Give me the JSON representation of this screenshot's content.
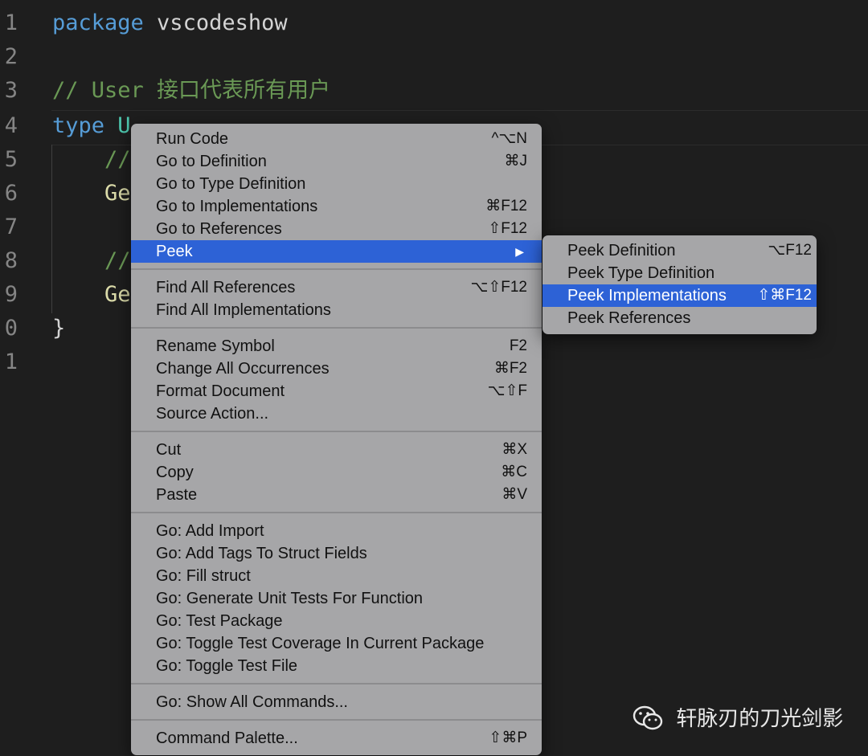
{
  "editor": {
    "lines": [
      {
        "num": "1",
        "tokens": [
          {
            "t": "package",
            "c": "kw"
          },
          {
            "t": " vscodeshow",
            "c": "plain"
          }
        ]
      },
      {
        "num": "2",
        "tokens": []
      },
      {
        "num": "3",
        "tokens": [
          {
            "t": "// User 接口代表所有用户",
            "c": "cmt"
          }
        ]
      },
      {
        "num": "4",
        "tokens": [
          {
            "t": "type",
            "c": "kw"
          },
          {
            "t": " U",
            "c": "ident"
          }
        ]
      },
      {
        "num": "5",
        "tokens": [
          {
            "t": "    //",
            "c": "cmt"
          }
        ]
      },
      {
        "num": "6",
        "tokens": [
          {
            "t": "    Ge",
            "c": "fn"
          }
        ]
      },
      {
        "num": "7",
        "tokens": []
      },
      {
        "num": "8",
        "tokens": [
          {
            "t": "    //",
            "c": "cmt"
          }
        ]
      },
      {
        "num": "9",
        "tokens": [
          {
            "t": "    Ge",
            "c": "fn"
          }
        ]
      },
      {
        "num": "0",
        "tokens": [
          {
            "t": "}",
            "c": "plain"
          }
        ]
      },
      {
        "num": "1",
        "tokens": []
      }
    ]
  },
  "context_menu": {
    "groups": [
      [
        {
          "label": "Run Code",
          "shortcut": "^⌥N"
        },
        {
          "label": "Go to Definition",
          "shortcut": "⌘J"
        },
        {
          "label": "Go to Type Definition",
          "shortcut": ""
        },
        {
          "label": "Go to Implementations",
          "shortcut": "⌘F12"
        },
        {
          "label": "Go to References",
          "shortcut": "⇧F12"
        },
        {
          "label": "Peek",
          "shortcut": "",
          "submenu": true,
          "selected": true
        }
      ],
      [
        {
          "label": "Find All References",
          "shortcut": "⌥⇧F12"
        },
        {
          "label": "Find All Implementations",
          "shortcut": ""
        }
      ],
      [
        {
          "label": "Rename Symbol",
          "shortcut": "F2"
        },
        {
          "label": "Change All Occurrences",
          "shortcut": "⌘F2"
        },
        {
          "label": "Format Document",
          "shortcut": "⌥⇧F"
        },
        {
          "label": "Source Action...",
          "shortcut": ""
        }
      ],
      [
        {
          "label": "Cut",
          "shortcut": "⌘X"
        },
        {
          "label": "Copy",
          "shortcut": "⌘C"
        },
        {
          "label": "Paste",
          "shortcut": "⌘V"
        }
      ],
      [
        {
          "label": "Go: Add Import",
          "shortcut": ""
        },
        {
          "label": "Go: Add Tags To Struct Fields",
          "shortcut": ""
        },
        {
          "label": "Go: Fill struct",
          "shortcut": ""
        },
        {
          "label": "Go: Generate Unit Tests For Function",
          "shortcut": ""
        },
        {
          "label": "Go: Test Package",
          "shortcut": ""
        },
        {
          "label": "Go: Toggle Test Coverage In Current Package",
          "shortcut": ""
        },
        {
          "label": "Go: Toggle Test File",
          "shortcut": ""
        }
      ],
      [
        {
          "label": "Go: Show All Commands...",
          "shortcut": ""
        }
      ],
      [
        {
          "label": "Command Palette...",
          "shortcut": "⇧⌘P"
        }
      ]
    ],
    "submenu_arrow": "▶"
  },
  "peek_submenu": {
    "items": [
      {
        "label": "Peek Definition",
        "shortcut": "⌥F12"
      },
      {
        "label": "Peek Type Definition",
        "shortcut": ""
      },
      {
        "label": "Peek Implementations",
        "shortcut": "⇧⌘F12",
        "selected": true
      },
      {
        "label": "Peek References",
        "shortcut": ""
      }
    ]
  },
  "watermark": {
    "text": "轩脉刃的刀光剑影",
    "icon": "wechat-icon"
  },
  "colors": {
    "selection": "#2d62d6",
    "menu_bg": "#a6a6a8",
    "editor_bg": "#1e1e1e"
  }
}
